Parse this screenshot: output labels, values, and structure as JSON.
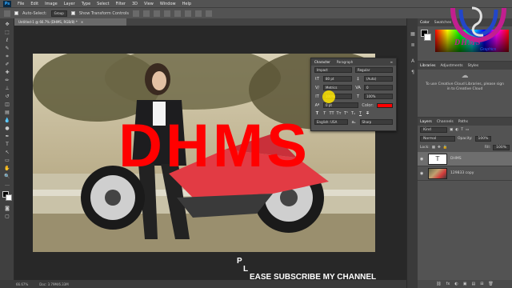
{
  "menubar": {
    "logo": "Ps",
    "items": [
      "File",
      "Edit",
      "Image",
      "Layer",
      "Type",
      "Select",
      "Filter",
      "3D",
      "View",
      "Window",
      "Help"
    ]
  },
  "options": {
    "auto_select": "Auto-Select:",
    "auto_select_value": "Group",
    "transform": "Show Transform Controls"
  },
  "document": {
    "tab": "Untitled-1 @ 66.7% (DHMS, RGB/8) *",
    "close": "×"
  },
  "canvas_text": "DHMS",
  "character_panel": {
    "tabs": [
      "Character",
      "Paragraph"
    ],
    "menu_icon": "≡",
    "font_family": "Impact",
    "font_style": "Regular",
    "font_size": "80 pt",
    "leading": "(Auto)",
    "kerning": "Metrics",
    "tracking": "0",
    "vertical_scale": "100%",
    "horizontal_scale": "100%",
    "baseline": "0 pt",
    "color_label": "Color:",
    "color": "#ff0000",
    "glyph_styles": [
      "T",
      "T",
      "TT",
      "Tт",
      "T¹",
      "T₁",
      "T",
      "T"
    ],
    "language": "English: USA",
    "antialias_label": "aₐ",
    "antialias": "Sharp"
  },
  "right_panels": {
    "color_tabs": [
      "Color",
      "Swatches"
    ],
    "library_tabs": [
      "Libraries",
      "Adjustments",
      "Styles"
    ],
    "library_text": "To use Creative Cloud Libraries, please sign in to Creative Cloud",
    "library_link": "sign in",
    "layers_tabs": [
      "Layers",
      "Channels",
      "Paths"
    ],
    "kind_label": "Kind",
    "blend_mode": "Normal",
    "opacity_label": "Opacity:",
    "opacity": "100%",
    "lock_label": "Lock:",
    "fill_label": "Fill:",
    "fill": "100%",
    "layers": [
      {
        "name": "DHMS",
        "type": "text",
        "selected": true
      },
      {
        "name": "129833 copy",
        "type": "image",
        "selected": false
      }
    ],
    "bottom_icons": [
      "fx",
      "◐",
      "▣",
      "▤",
      "⊞",
      "🗑"
    ]
  },
  "watermark": {
    "letters": "DHMS",
    "subtitle": "Graphics"
  },
  "status": {
    "zoom": "66.67%",
    "doc": "Doc: 3.79M/6.33M"
  },
  "overlay_text": {
    "line1": "P",
    "line2": "L",
    "line3": "EASE SUBSCRIBE MY CHANNEL"
  },
  "colors": {
    "accent_red": "#ff0000",
    "ui_dark": "#535353",
    "workspace": "#282828"
  }
}
